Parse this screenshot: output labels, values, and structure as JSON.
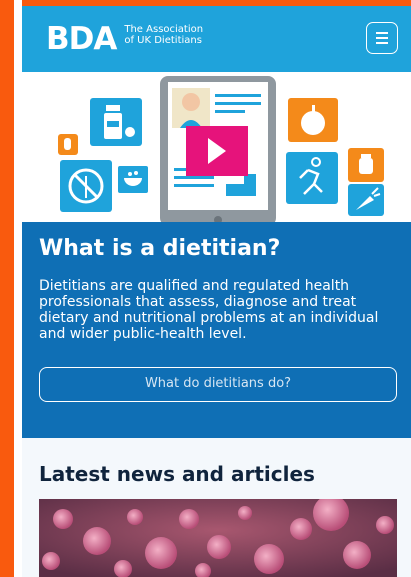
{
  "header": {
    "logo_mark": "BDA",
    "logo_line1": "The Association",
    "logo_line2": "of UK Dietitians",
    "menu_icon": "hamburger-icon"
  },
  "hero": {
    "icons": [
      "medicine-jar-icon",
      "pill-icon",
      "wheat-free-icon",
      "meal-bowl-icon",
      "apple-icon",
      "runner-icon",
      "fruit-jar-icon",
      "carrot-icon",
      "play-icon",
      "tablet-device-icon"
    ],
    "accent": "#1fa3db",
    "orange": "#f48a1a",
    "play_color": "#e6137b"
  },
  "intro": {
    "heading": "What is a dietitian?",
    "body": "Dietitians are qualified and regulated health professionals that assess, diagnose and treat dietary and nutritional problems at an individual and wider public-health level.",
    "cta_label": "What do dietitians do?"
  },
  "news": {
    "heading": "Latest news and articles",
    "image_icon": "virus-image"
  },
  "colors": {
    "page_border": "#f95a0e",
    "panel_blue": "#0f6fb5",
    "header_blue": "#1fa3db"
  }
}
